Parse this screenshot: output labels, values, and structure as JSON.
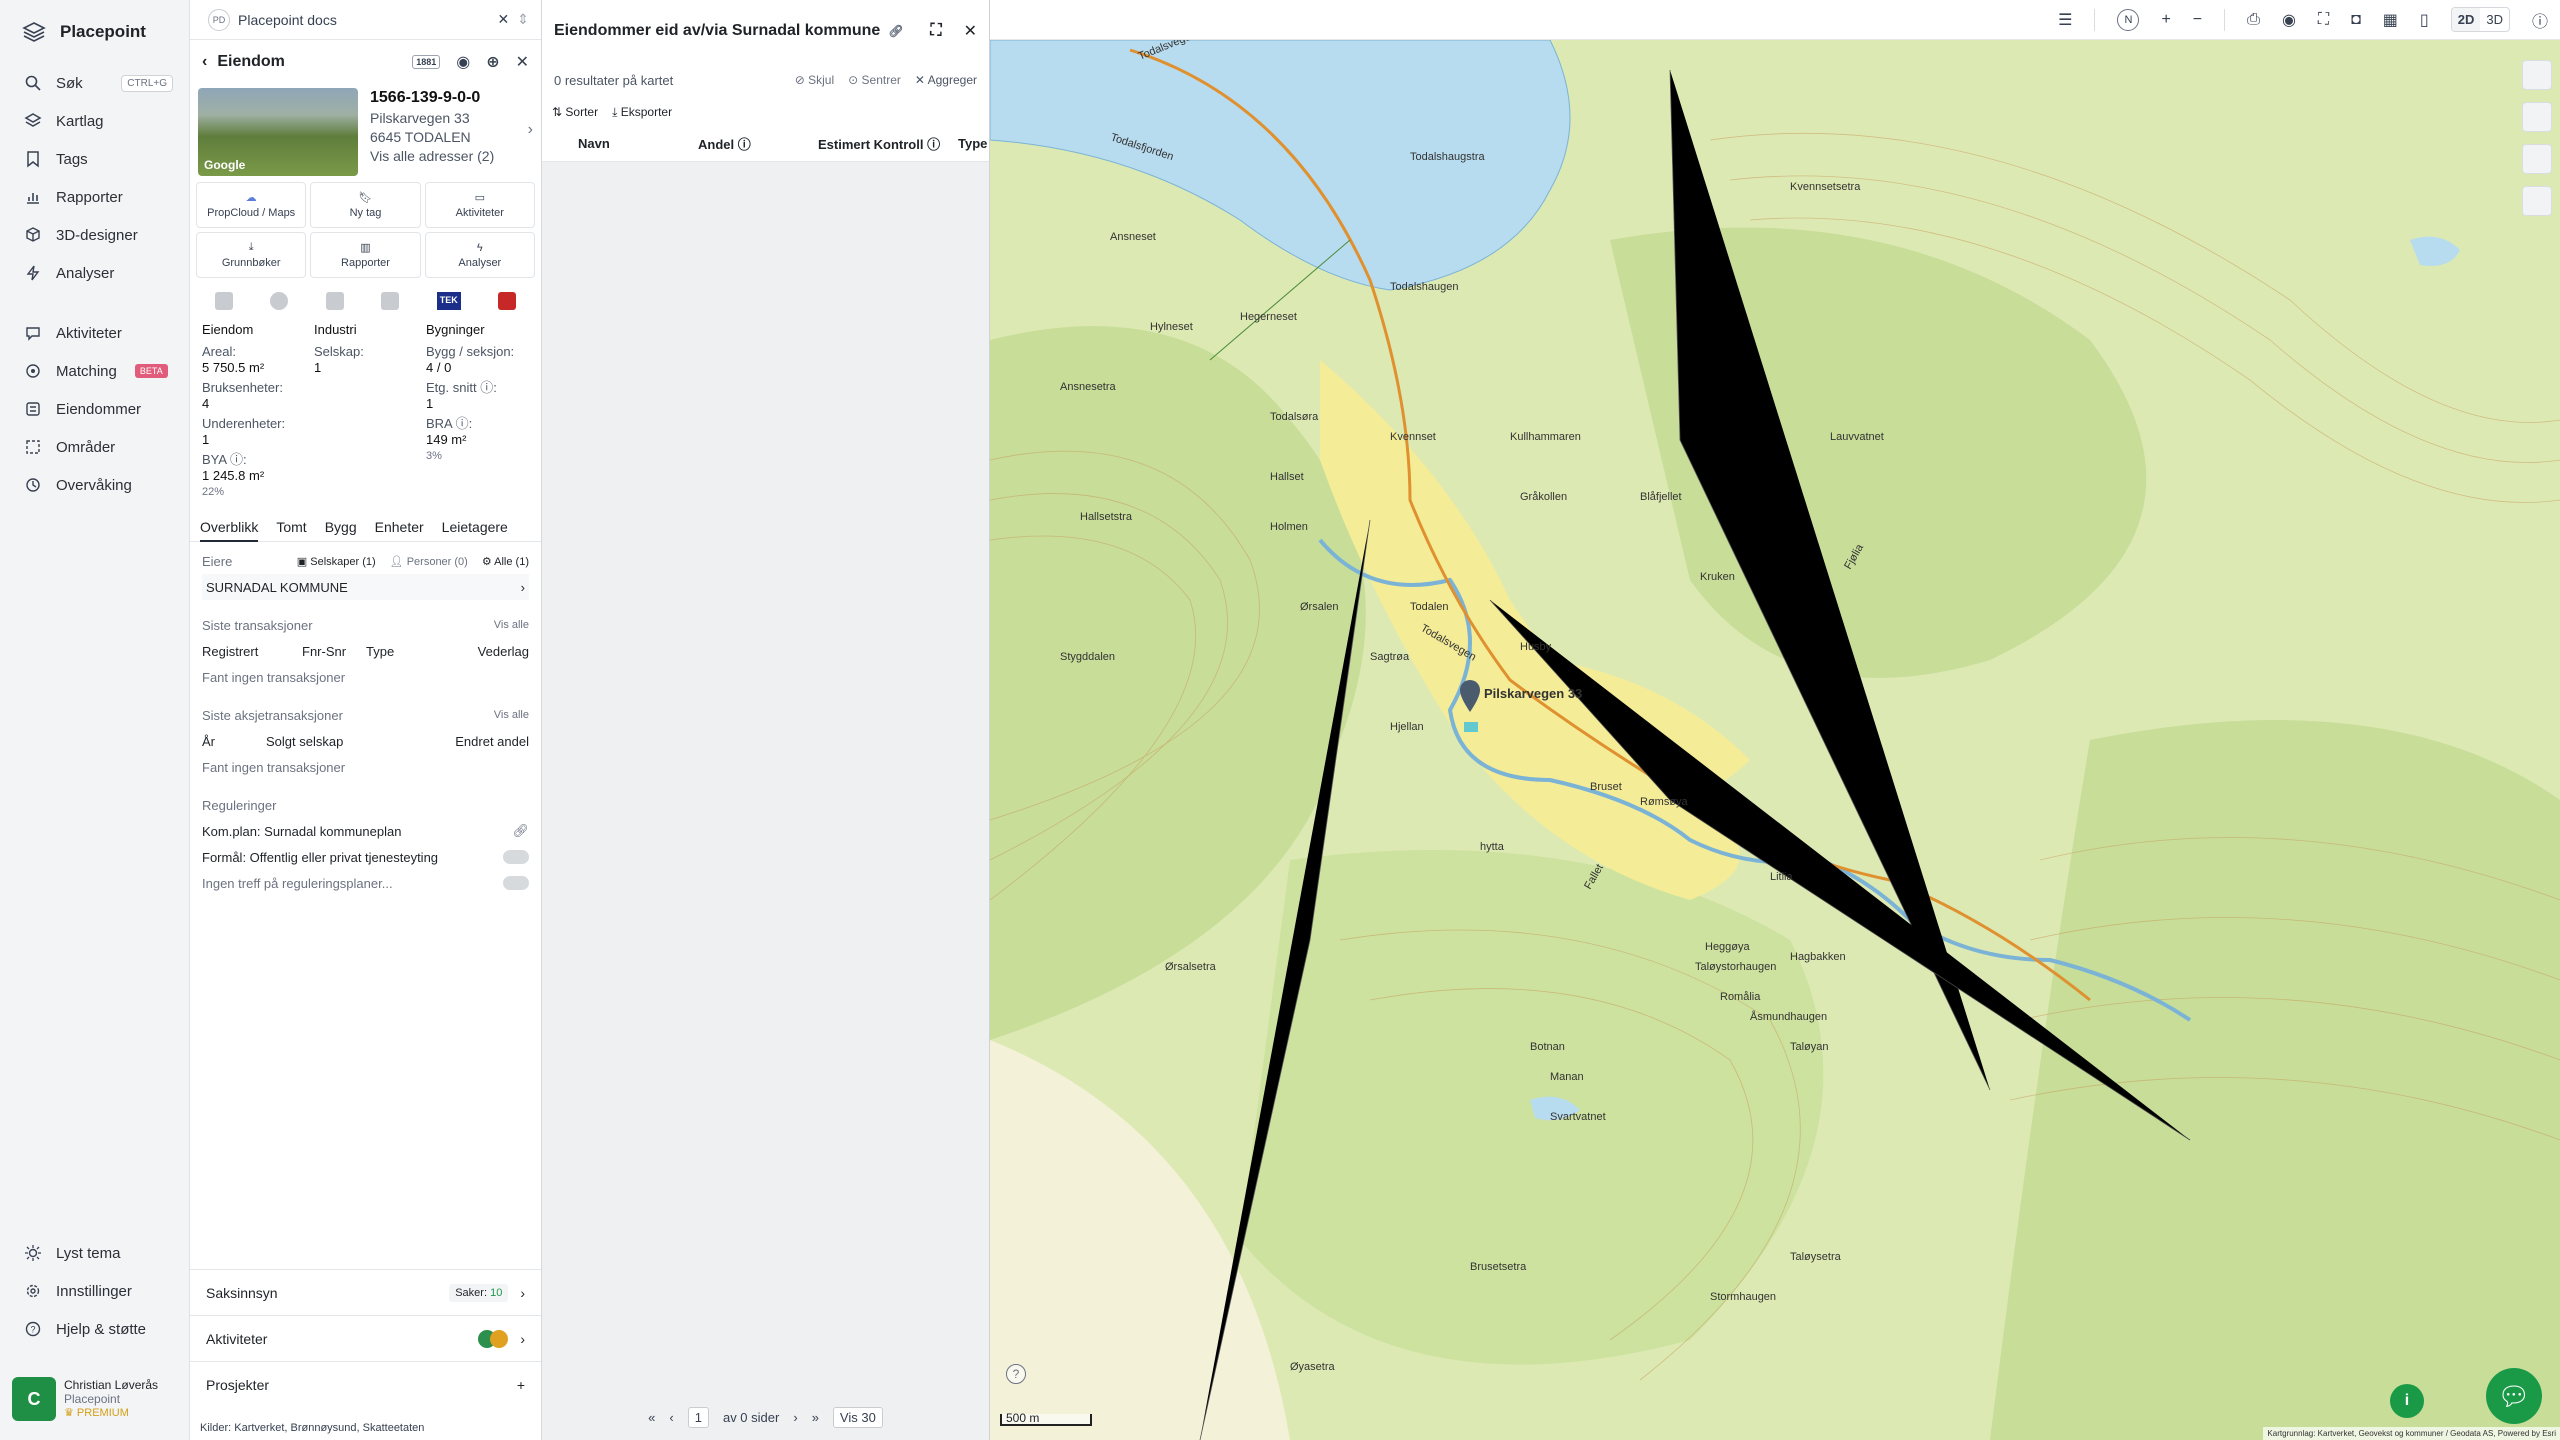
{
  "app": {
    "name": "Placepoint"
  },
  "sidebar": {
    "items": [
      {
        "label": "Søk",
        "icon": "search-icon",
        "kbd": "CTRL+G"
      },
      {
        "label": "Kartlag",
        "icon": "layers-icon"
      },
      {
        "label": "Tags",
        "icon": "bookmark-icon"
      },
      {
        "label": "Rapporter",
        "icon": "chart-icon"
      },
      {
        "label": "3D-designer",
        "icon": "cube-icon"
      },
      {
        "label": "Analyser",
        "icon": "lightning-icon"
      }
    ],
    "items2": [
      {
        "label": "Aktiviteter",
        "icon": "chat-icon"
      },
      {
        "label": "Matching",
        "icon": "target-icon",
        "badge": "BETA"
      },
      {
        "label": "Eiendommer",
        "icon": "list-icon"
      },
      {
        "label": "Områder",
        "icon": "area-icon"
      },
      {
        "label": "Overvåking",
        "icon": "eye-icon"
      }
    ],
    "bottom": [
      {
        "label": "Lyst tema",
        "icon": "sun-icon"
      },
      {
        "label": "Innstillinger",
        "icon": "gear-icon"
      },
      {
        "label": "Hjelp & støtte",
        "icon": "help-icon"
      }
    ],
    "user": {
      "initial": "C",
      "name": "Christian Løverås",
      "org": "Placepoint",
      "plan": "PREMIUM"
    }
  },
  "docs": {
    "badge": "PD",
    "title": "Placepoint docs"
  },
  "panel": {
    "title": "Eiendom",
    "badge": "1881",
    "prop": {
      "id": "1566-139-9-0-0",
      "street": "Pilskarvegen 33",
      "postal": "6645 TODALEN",
      "all_addr": "Vis alle adresser (2)",
      "thumb_label": "Google"
    },
    "tiles": [
      "PropCloud / Maps",
      "Ny tag",
      "Aktiviteter",
      "Grunnbøker",
      "Rapporter",
      "Analyser"
    ],
    "tek": "TEK",
    "stats": {
      "c1": {
        "h": "Eiendom",
        "k1": "Areal:",
        "v1": "5 750.5 m²",
        "k2": "Bruksenheter:",
        "v2": "4",
        "k3": "Underenheter:",
        "v3": "1",
        "k4": "BYA ⓘ:",
        "v4": "1 245.8 m²",
        "p4": "22%"
      },
      "c2": {
        "h": "Industri",
        "k1": "Selskap:",
        "v1": "1"
      },
      "c3": {
        "h": "Bygninger",
        "k1": "Bygg / seksjon:",
        "v1": "4 / 0",
        "k2": "Etg. snitt ⓘ:",
        "v2": "1",
        "k3": "BRA ⓘ:",
        "v3": "149 m²",
        "p3": "3%"
      }
    },
    "tabs": [
      "Overblikk",
      "Tomt",
      "Bygg",
      "Enheter",
      "Leietagere"
    ],
    "owners": {
      "title": "Eiere",
      "f1": "Selskaper (1)",
      "f2": "Personer (0)",
      "f3": "Alle (1)",
      "owner": "SURNADAL KOMMUNE"
    },
    "trans": {
      "title": "Siste transaksjoner",
      "show": "Vis alle",
      "cols": [
        "Registrert",
        "Fnr-Snr",
        "Type",
        "Vederlag"
      ],
      "empty": "Fant ingen transaksjoner"
    },
    "stock": {
      "title": "Siste aksjetransaksjoner",
      "show": "Vis alle",
      "cols": [
        "År",
        "Solgt selskap",
        "Endret andel"
      ],
      "empty": "Fant ingen transaksjoner"
    },
    "reg": {
      "title": "Reguleringer",
      "l1": "Kom.plan: Surnadal kommuneplan",
      "l2": "Formål: Offentlig eller privat tjenesteyting",
      "l3": "Ingen treff på reguleringsplaner..."
    },
    "saks": {
      "label": "Saksinnsyn",
      "count_label": "Saker:",
      "count": "10"
    },
    "akt": {
      "label": "Aktiviteter"
    },
    "prosjekter": {
      "label": "Prosjekter"
    },
    "kilder": {
      "label": "Kilder:",
      "items": "Kartverket, Brønnøysund, Skatteetaten"
    }
  },
  "results": {
    "title": "Eiendommer eid av/via Surnadal kommune",
    "count": "0 resultater på kartet",
    "skjul": "Skjul",
    "sentrer": "Sentrer",
    "aggreger": "Aggreger",
    "sorter": "Sorter",
    "eksporter": "Eksporter",
    "cols": [
      "Navn",
      "Andel ⓘ",
      "Estimert Kontroll ⓘ",
      "Type"
    ],
    "pager": {
      "page": "1",
      "of": "av 0 sider",
      "per": "Vis 30"
    }
  },
  "topbar": {
    "north": "N",
    "mode2d": "2D",
    "mode3d": "3D"
  },
  "map": {
    "scale": "500 m",
    "attrib": "Kartgrunnlag: Kartverket, Geovekst og kommuner / Geodata AS, Powered by Esri",
    "marker_label": "Pilskarvegen 33",
    "places": [
      "Todalsvegen",
      "Todalsfjorden",
      "Todalshaugstra",
      "Ansneset",
      "Hylneset",
      "Hegerneset",
      "Todalshaugen",
      "Ansnesetra",
      "Todalsøra",
      "Kvennset",
      "Kullhammaren",
      "Gråkollen",
      "Blåfjellet",
      "Hallset",
      "Hallsetstra",
      "Holmen",
      "Ørsalen",
      "Todalen",
      "Sagtrøa",
      "Husby",
      "Kruken",
      "Stygddalen",
      "Hjellan",
      "Bruset",
      "Rømsøya",
      "hytta",
      "Todalsvegen",
      "Ørsalsetra",
      "Taløystorhaugen",
      "Botnan",
      "Manan",
      "Heggøya",
      "Hagbakken",
      "Åsmundhaugen",
      "Brusetsetra",
      "Stormhaugen",
      "Øyasetra",
      "Taløysetra",
      "Kvennsetsetra",
      "Svartvatnet",
      "Lauvvatnet",
      "Litlia",
      "Taløyan",
      "Fallet",
      "Romålia",
      "Fjølia"
    ]
  }
}
